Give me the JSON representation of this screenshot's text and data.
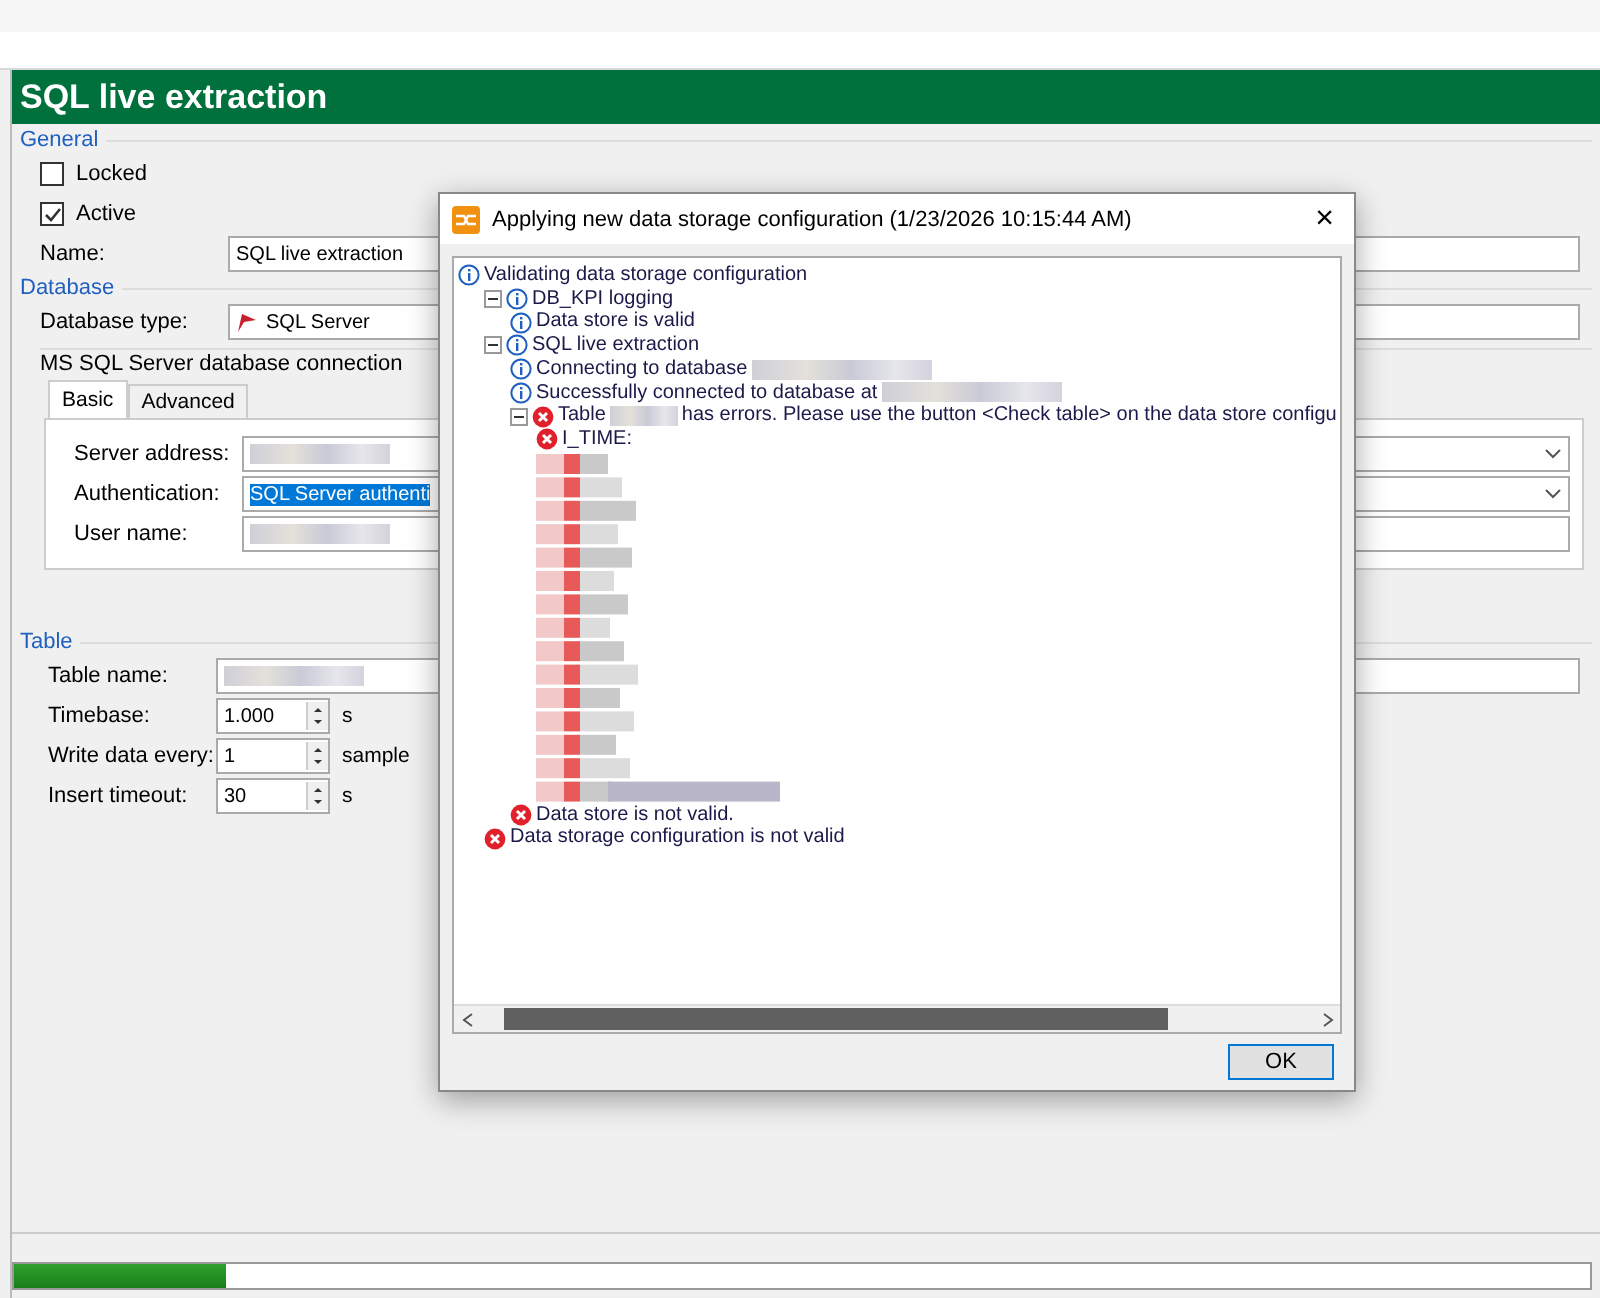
{
  "page_title": "SQL live extraction",
  "general": {
    "heading": "General",
    "checkboxes": [
      {
        "label": "Locked",
        "checked": false
      },
      {
        "label": "Active",
        "checked": true
      }
    ],
    "name_label": "Name:",
    "name_value": "SQL live extraction"
  },
  "database": {
    "heading": "Database",
    "type_label": "Database type:",
    "type_value": "SQL Server",
    "group_title": "MS SQL Server database connection",
    "tabs": [
      {
        "label": "Basic",
        "selected": true
      },
      {
        "label": "Advanced",
        "selected": false
      }
    ],
    "fields": [
      {
        "kind": "select",
        "label": "Server address:",
        "redacted": true
      },
      {
        "kind": "select",
        "label": "Authentication:",
        "value": "SQL Server authenti",
        "highlighted": true
      },
      {
        "kind": "input",
        "label": "User name:",
        "redacted": true
      }
    ]
  },
  "table": {
    "heading": "Table",
    "fields": [
      {
        "kind": "input",
        "label": "Table name:",
        "redacted": true
      },
      {
        "kind": "spinner",
        "label": "Timebase:",
        "value": "1.000",
        "unit": "s"
      },
      {
        "kind": "spinner",
        "label": "Write data every:",
        "value": "1",
        "unit": "sample"
      },
      {
        "kind": "spinner",
        "label": "Insert timeout:",
        "value": "30",
        "unit": "s"
      }
    ]
  },
  "dialog": {
    "title": "Applying new data storage configuration (1/23/2026 10:15:44 AM)",
    "close": "×",
    "ok": "OK",
    "tree": [
      {
        "kind": "info",
        "text": "Validating data storage configuration",
        "children": [
          {
            "kind": "info",
            "text": "DB_KPI logging",
            "expanded": true,
            "children": [
              {
                "kind": "info",
                "text": "Data store is valid"
              }
            ]
          },
          {
            "kind": "info",
            "text": "SQL live extraction",
            "expanded": true,
            "children": [
              {
                "kind": "info",
                "text": "Connecting to database",
                "redacted": true
              },
              {
                "kind": "info",
                "text": "Successfully connected to database at",
                "redacted": true
              },
              {
                "kind": "error",
                "text": "Table",
                "redacted": true,
                "text_after": "has errors. Please use the button <Check table> on the data store configu",
                "expanded": true,
                "children": [
                  {
                    "kind": "error",
                    "text": "I_TIME:"
                  },
                  {
                    "kind": "hidden_rows"
                  }
                ]
              },
              {
                "kind": "error",
                "text": "Data store is not valid."
              }
            ]
          },
          {
            "kind": "error",
            "text": "Data storage configuration is not valid"
          }
        ]
      }
    ]
  },
  "progress": {
    "level": 0.135
  }
}
